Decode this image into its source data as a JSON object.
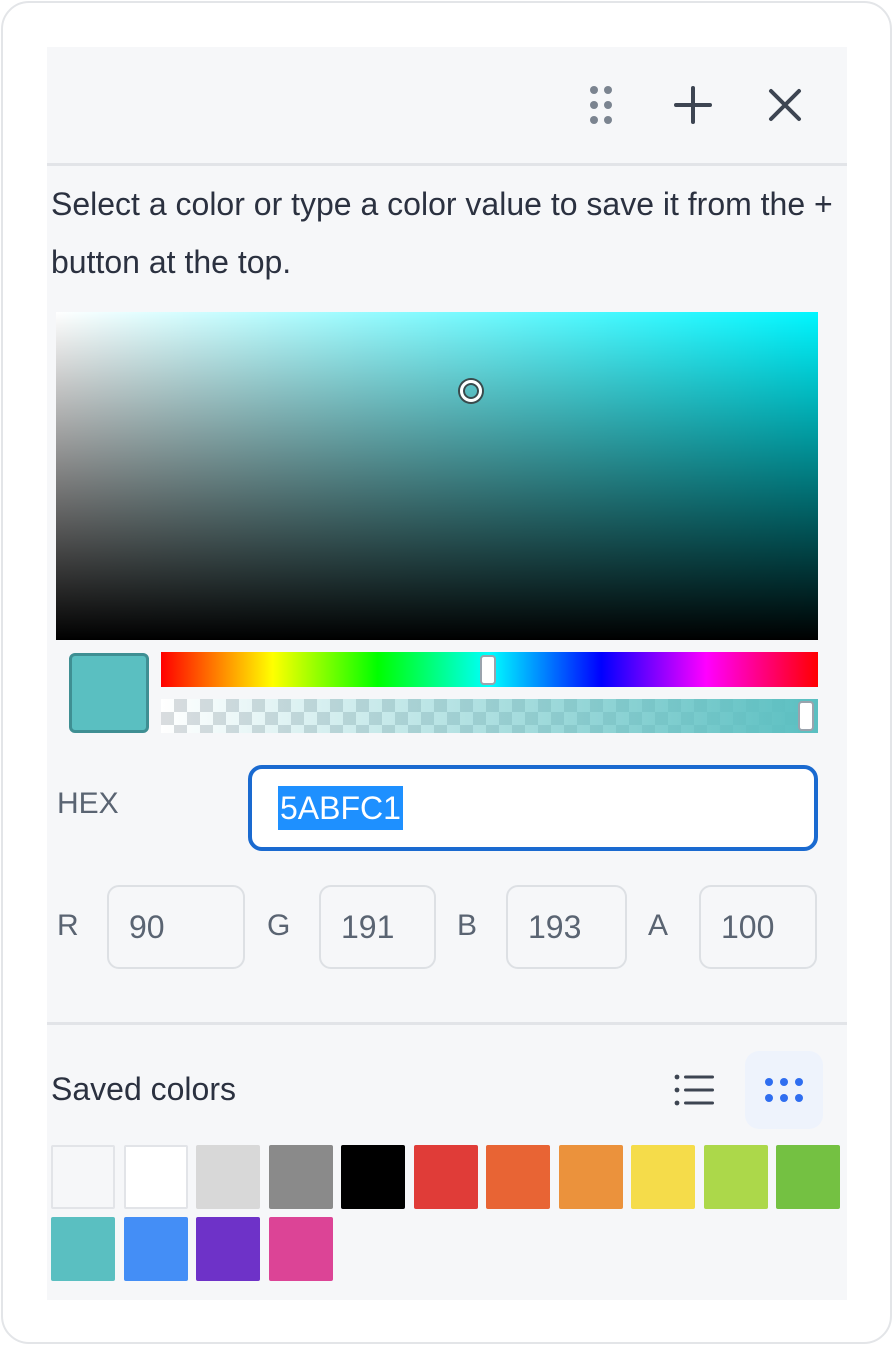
{
  "instructions": "Select a color or type a color value to save it from the + button at the top.",
  "toolbar": {
    "drag_icon": "drag-handle-icon",
    "add_icon": "plus-icon",
    "close_icon": "close-icon"
  },
  "picker": {
    "hue_color": "#00f6ff",
    "current_color": "#5ABFC1",
    "hue_fraction": 0.5,
    "alpha_fraction": 1.0
  },
  "hex": {
    "label": "HEX",
    "value": "5ABFC1"
  },
  "channels": [
    {
      "label": "R",
      "value": "90"
    },
    {
      "label": "G",
      "value": "191"
    },
    {
      "label": "B",
      "value": "193"
    },
    {
      "label": "A",
      "value": "100"
    }
  ],
  "saved": {
    "title": "Saved colors",
    "list_view_icon": "list-view-icon",
    "grid_view_icon": "grid-view-icon",
    "colors": [
      "#f6f7f9",
      "#ffffff",
      "#d8d8d8",
      "#8a8a8a",
      "#000000",
      "#e03c38",
      "#e86434",
      "#eb923c",
      "#f5dc4a",
      "#acd84a",
      "#74c142",
      "#5abfc1",
      "#448ef6",
      "#6e32c8",
      "#dc4496"
    ]
  }
}
